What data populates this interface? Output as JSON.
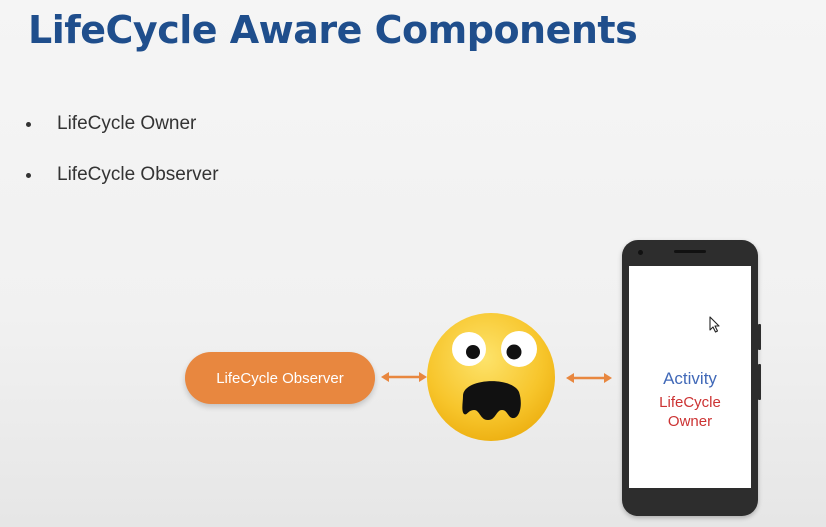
{
  "slide": {
    "title": "LifeCycle Aware Components",
    "bullets": [
      "LifeCycle Owner",
      "LifeCycle Observer"
    ]
  },
  "diagram": {
    "observer_label": "LifeCycle Observer",
    "phone": {
      "activity_label": "Activity",
      "owner_label": "LifeCycle Owner"
    },
    "emoji_icon": "surprised-face-icon",
    "arrow_icon": "double-arrow-icon"
  },
  "colors": {
    "title": "#1f4e8c",
    "observer_pill": "#e8873f",
    "arrow": "#e8873f",
    "activity_text": "#4169b8",
    "owner_text": "#cc3333",
    "emoji": "#f7c52b"
  }
}
